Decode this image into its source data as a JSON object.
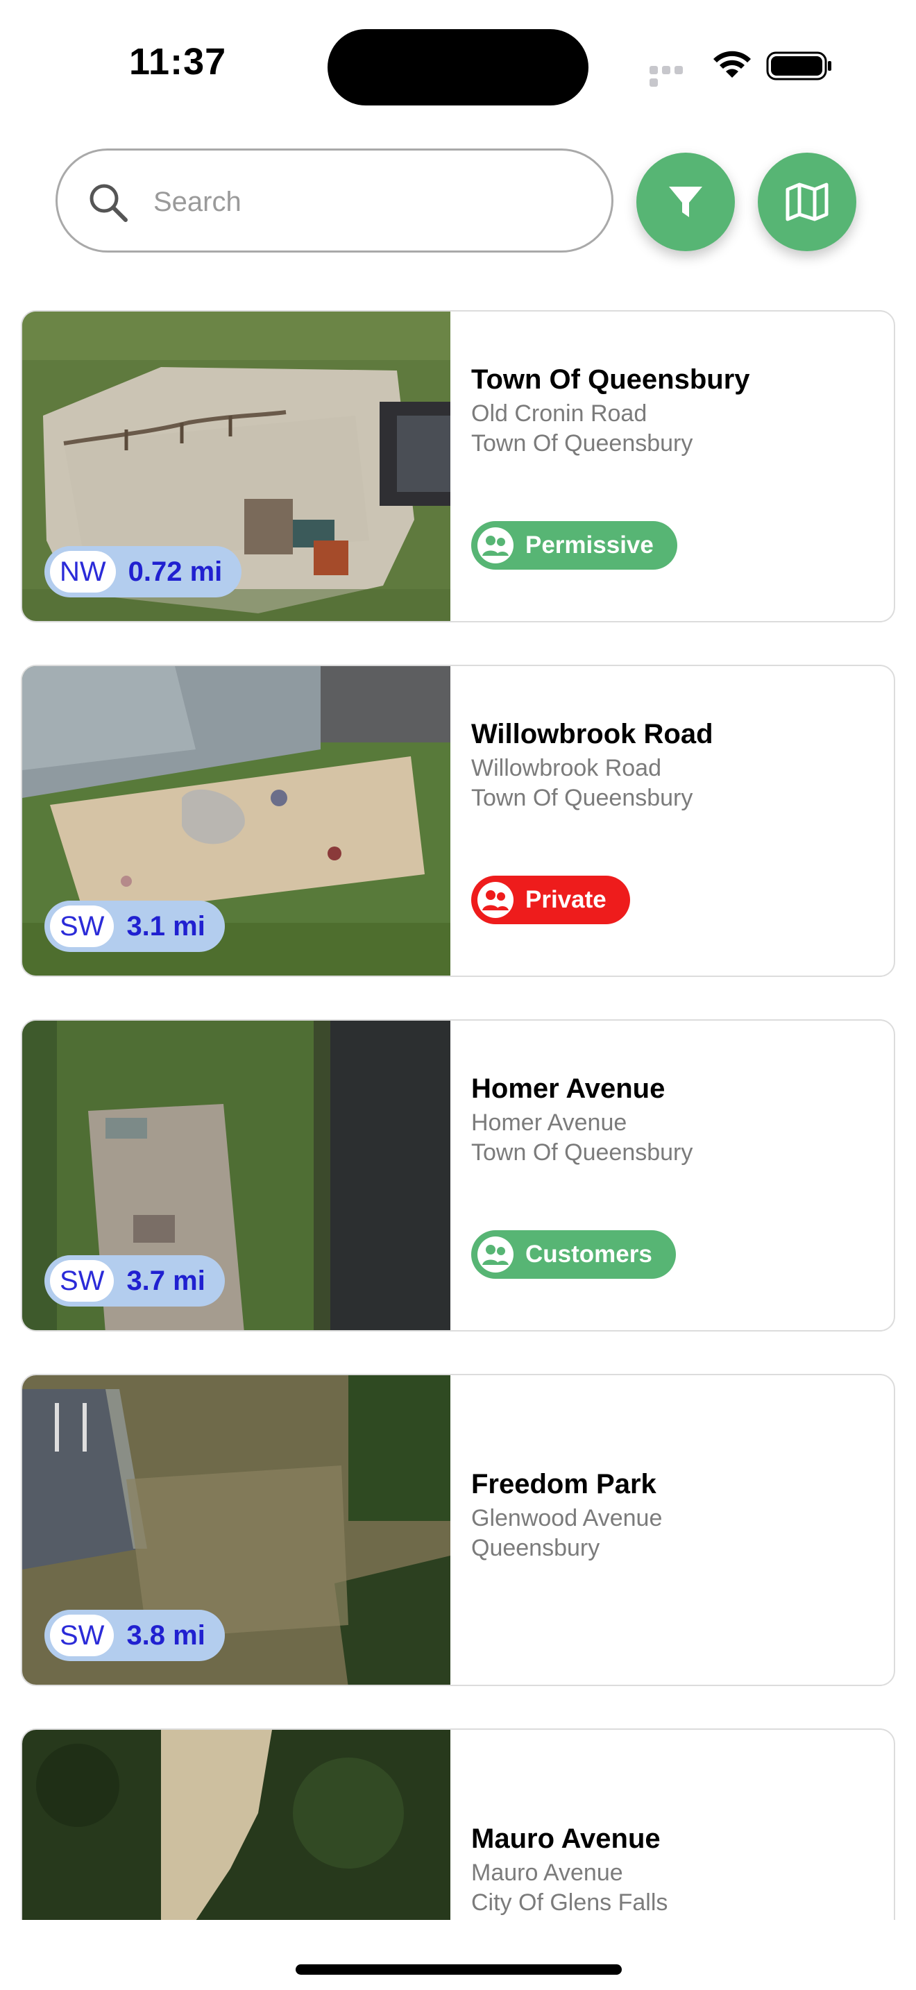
{
  "status_bar": {
    "time": "11:37"
  },
  "search": {
    "placeholder": "Search",
    "value": ""
  },
  "toolbar": {
    "filter_icon": "filter-icon",
    "map_icon": "map-icon"
  },
  "colors": {
    "accent": "#57b574",
    "private": "#ee1c1c",
    "badge_bg": "#b3cdee",
    "badge_text": "#2020d0"
  },
  "places": [
    {
      "name": "Town Of Queensbury",
      "lines": [
        "Old Cronin Road",
        "Town Of Queensbury"
      ],
      "direction": "NW",
      "distance": "0.72 mi",
      "access": {
        "label": "Permissive",
        "kind": "green"
      }
    },
    {
      "name": "Willowbrook Road",
      "lines": [
        "Willowbrook Road",
        "Town Of Queensbury"
      ],
      "direction": "SW",
      "distance": "3.1 mi",
      "access": {
        "label": "Private",
        "kind": "red"
      }
    },
    {
      "name": "Homer Avenue",
      "lines": [
        "Homer Avenue",
        "Town Of Queensbury"
      ],
      "direction": "SW",
      "distance": "3.7 mi",
      "access": {
        "label": "Customers",
        "kind": "green"
      }
    },
    {
      "name": "Freedom Park",
      "lines": [
        "Glenwood Avenue",
        "Queensbury"
      ],
      "direction": "SW",
      "distance": "3.8 mi",
      "access": null
    },
    {
      "name": "Mauro Avenue",
      "lines": [
        "Mauro Avenue",
        "City Of Glens Falls"
      ],
      "direction": "",
      "distance": "",
      "access": null
    }
  ]
}
